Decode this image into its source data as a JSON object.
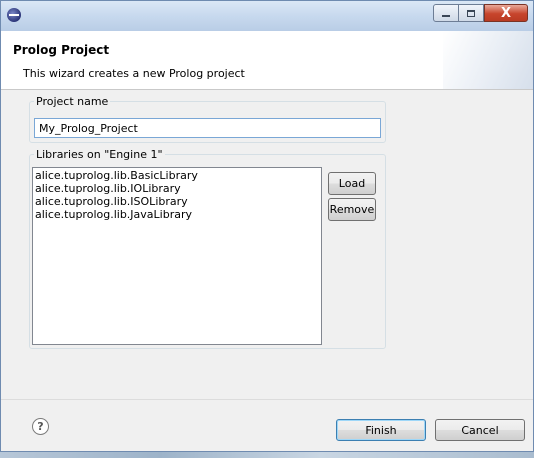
{
  "window": {
    "title": "",
    "controls": {
      "minimize": "",
      "maximize": "",
      "close": "X"
    }
  },
  "header": {
    "title": "Prolog Project",
    "description": "This wizard creates a new Prolog project"
  },
  "project_name": {
    "label": "Project name",
    "value": "My_Prolog_Project"
  },
  "libraries": {
    "label": "Libraries on \"Engine 1\"",
    "items": [
      "alice.tuprolog.lib.BasicLibrary",
      "alice.tuprolog.lib.IOLibrary",
      "alice.tuprolog.lib.ISOLibrary",
      "alice.tuprolog.lib.JavaLibrary"
    ],
    "load_label": "Load",
    "remove_label": "Remove"
  },
  "footer": {
    "help_glyph": "?",
    "finish_label": "Finish",
    "cancel_label": "Cancel"
  },
  "icons": {
    "app": "eclipse-icon",
    "help": "help-icon"
  },
  "colors": {
    "title_bar": "#c7d9ee",
    "close_button": "#c7452c",
    "focus_border": "#7aa7d6",
    "dialog_bg": "#f0f0f0"
  }
}
